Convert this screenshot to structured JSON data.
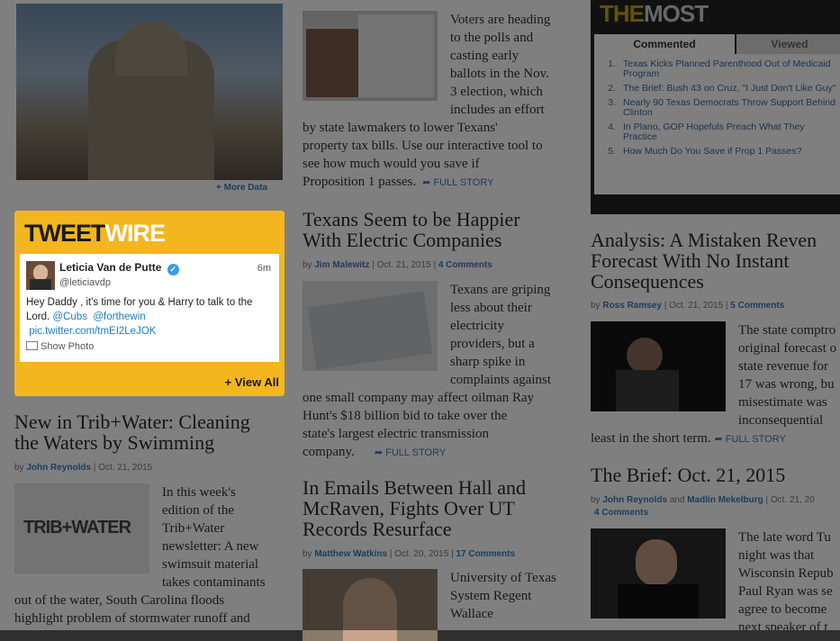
{
  "top_photo": {
    "more_label": "+ More Data"
  },
  "articles": {
    "voters": {
      "text": "Voters are heading to the polls and casting early ballots in the Nov. 3 election, which includes an effort by state lawmakers to lower Texans' property tax bills. Use our interactive tool to see how much would you save if Proposition 1 passes.",
      "line1": "Voters are heading",
      "line2": "to the polls and",
      "line3": "casting early",
      "line4": "ballots in the Nov.",
      "line5": "3 election, which",
      "line6": "includes an effort",
      "line7": "by state lawmakers to lower Texans'",
      "line8": "property tax bills. Use our interactive tool to",
      "line9": "see how much would you save if",
      "line10": "Proposition 1 passes.",
      "full_story": "FULL STORY"
    },
    "electric": {
      "title1": "Texans Seem to be Happier",
      "title2": "With Electric Companies",
      "by": "by",
      "author": "Jim Malewitz",
      "date": "Oct. 21, 2015",
      "comments": "4 Comments",
      "l1": "Texans are griping",
      "l2": "less about their",
      "l3": "electricity",
      "l4": "providers, but a",
      "l5": "sharp spike in",
      "l6": "complaints against",
      "l7": "one small company may affect oilman Ray",
      "l8": "Hunt's $18 billion bid to take over the",
      "l9": "state's largest electric transmission",
      "l10": "company.",
      "full_story": "FULL STORY"
    },
    "emails": {
      "title1": "In Emails Between Hall and",
      "title2": "McRaven, Fights Over UT",
      "title3": "Records Resurface",
      "by": "by",
      "author": "Matthew Watkins",
      "date": "Oct. 20, 2015",
      "comments": "17 Comments",
      "l1": "University of Texas",
      "l2": "System Regent",
      "l3": "Wallace"
    },
    "tribwater": {
      "title1": "New in Trib+Water: Cleaning",
      "title2": "the Waters by Swimming",
      "by": "by",
      "author": "John Reynolds",
      "date": "Oct. 21, 2015",
      "badge": "TRIB+WATER",
      "l1": "In this week's",
      "l2": "edition of the",
      "l3": "Trib+Water",
      "l4": "newsletter: A new",
      "l5": "swimsuit material",
      "l6": "takes contaminants",
      "l7": "out of the water, South Carolina floods",
      "l8": "highlight problem of stormwater runoff and"
    },
    "analysis": {
      "title1": "Analysis: A Mistaken Reven",
      "title2": "Forecast With No Instant",
      "title3": "Consequences",
      "by": "by",
      "author": "Ross Ramsey",
      "date": "Oct. 21, 2015",
      "comments": "5 Comments",
      "l1": "The state comptro",
      "l2": "original forecast o",
      "l3": "state revenue for",
      "l4": "17 was wrong, bu",
      "l5": "misestimate was",
      "l6": "inconsequential",
      "l7": "least in the short term.",
      "full_story": "FULL STORY"
    },
    "brief": {
      "title": "The Brief: Oct. 21, 2015",
      "by": "by",
      "author1": "John Reynolds",
      "and": "and",
      "author2": "Madlin Mekelburg",
      "date": "Oct. 21, 20",
      "comments": "4 Comments",
      "l1": "The late word Tu",
      "l2": "night was that",
      "l3": "Wisconsin Repub",
      "l4": "Paul Ryan was se",
      "l5": "agree to become",
      "l6": "next speaker of t"
    }
  },
  "tweetwire": {
    "title_a": "TWEET",
    "title_b": "WIRE",
    "name": "Leticia Van de Putte",
    "handle": "@leticiavdp",
    "time": "6m",
    "text": "Hey Daddy , it's time for you & Harry to talk to the Lord.",
    "mention1": "@Cubs",
    "mention2": "@forthewin",
    "link": "pic.twitter.com/tmEI2LeJOK",
    "show_photo": "Show Photo",
    "view_all": "+ View All",
    "colors": {
      "bg": "#f3b61e",
      "link": "#1e7bc0"
    }
  },
  "themost": {
    "logo_a": "THE",
    "logo_b": "MOST",
    "tabs": [
      "Commented",
      "Viewed"
    ],
    "items": [
      {
        "n": "1.",
        "t": "Texas Kicks Planned Parenthood Out of Medicaid Program"
      },
      {
        "n": "2.",
        "t": "The Brief: Bush 43 on Cruz, \"I Just Don't Like Guy\""
      },
      {
        "n": "3.",
        "t": "Nearly 90 Texas Democrats Throw Support Behind Clinton"
      },
      {
        "n": "4.",
        "t": "In Plano, GOP Hopefuls Preach What They Practice"
      },
      {
        "n": "5.",
        "t": "How Much Do You Save if Prop 1 Passes?"
      }
    ]
  }
}
